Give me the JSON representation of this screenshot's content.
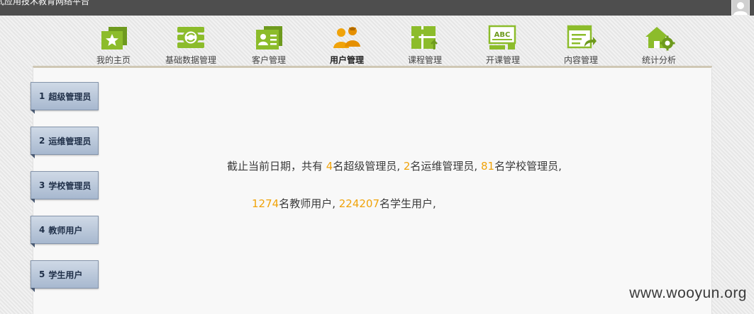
{
  "header": {
    "app_title": "式应用技术教育网络平台"
  },
  "nav": {
    "items": [
      {
        "label": "我的主页",
        "icon": "home-star-icon"
      },
      {
        "label": "基础数据管理",
        "icon": "data-sync-icon"
      },
      {
        "label": "客户管理",
        "icon": "customer-card-icon"
      },
      {
        "label": "用户管理",
        "icon": "users-icon"
      },
      {
        "label": "课程管理",
        "icon": "course-puzzle-icon"
      },
      {
        "label": "开课管理",
        "icon": "abc-board-icon"
      },
      {
        "label": "内容管理",
        "icon": "content-share-icon"
      },
      {
        "label": "统计分析",
        "icon": "stats-house-gear-icon"
      }
    ],
    "active": "用户管理"
  },
  "sidebar": {
    "tabs": [
      {
        "num": "1",
        "label": "超级管理员"
      },
      {
        "num": "2",
        "label": "运维管理员"
      },
      {
        "num": "3",
        "label": "学校管理员"
      },
      {
        "num": "4",
        "label": "教师用户"
      },
      {
        "num": "5",
        "label": "学生用户"
      }
    ]
  },
  "summary": {
    "line1": {
      "prefix": "截止当前日期，共有 ",
      "super_admin_count": "4",
      "super_admin_text": "名超级管理员, ",
      "ops_admin_count": "2",
      "ops_admin_text": "名运维管理员, ",
      "school_admin_count": "81",
      "school_admin_text": "名学校管理员,"
    },
    "line2": {
      "teacher_count": "1274",
      "teacher_text": "名教师用户, ",
      "student_count": "224207",
      "student_text": "名学生用户,"
    }
  },
  "watermark": "www.wooyun.org",
  "colors": {
    "highlight": "#f0a30a",
    "topbar": "#4e4e4e",
    "icon_green": "#8cbc2b",
    "icon_orange": "#f0a30a"
  }
}
